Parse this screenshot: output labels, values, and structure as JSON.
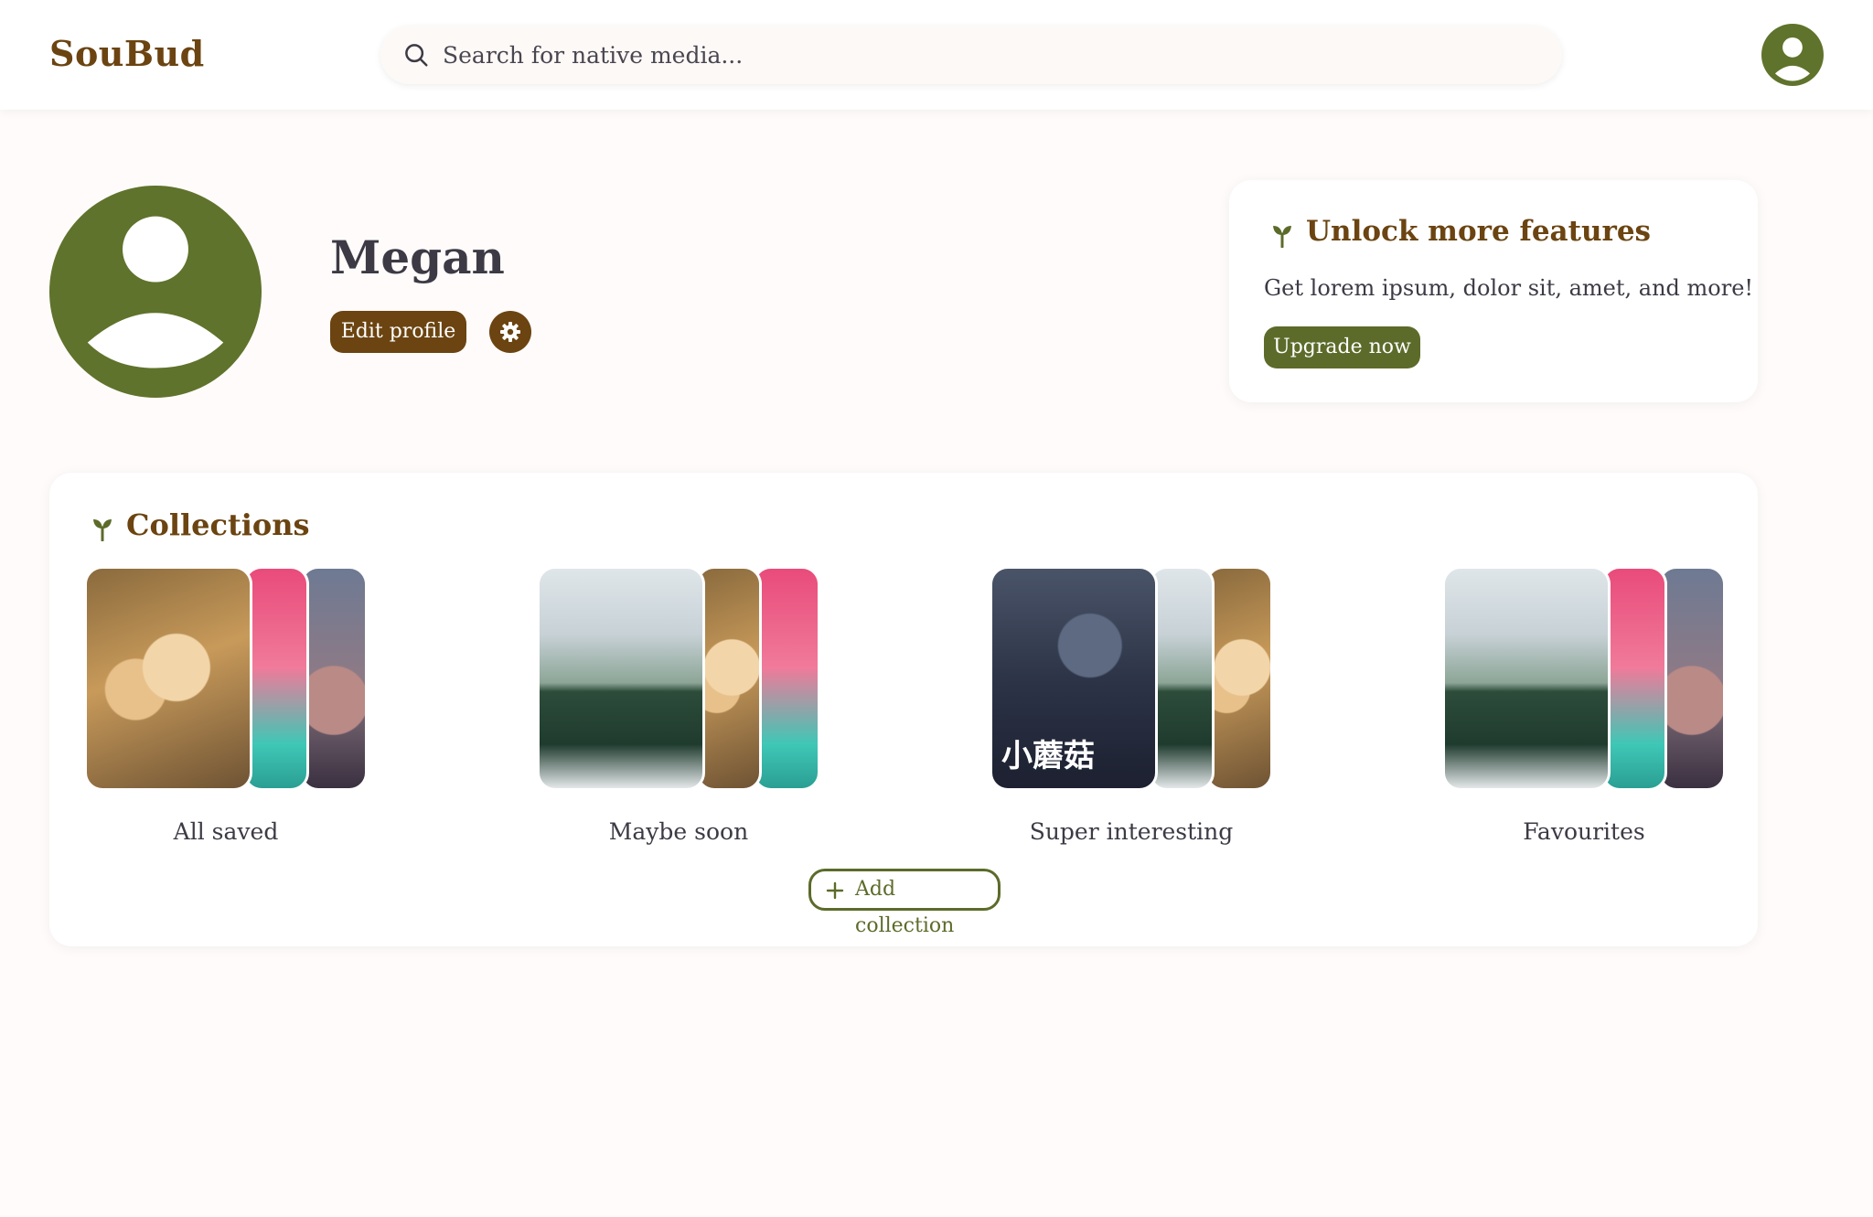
{
  "header": {
    "logo": "SouBud",
    "search_placeholder": "Search for native media...",
    "search_value": ""
  },
  "profile": {
    "name": "Megan",
    "edit_label": "Edit profile"
  },
  "promo": {
    "title": "Unlock more features",
    "text": "Get lorem ipsum, dolor sit, amet, and more!",
    "button_label": "Upgrade now"
  },
  "collections": {
    "title": "Collections",
    "items": [
      {
        "label": "All saved"
      },
      {
        "label": "Maybe soon"
      },
      {
        "label": "Super interesting",
        "poster_text": "小蘑菇"
      },
      {
        "label": "Favourites"
      }
    ],
    "add_label": "Add collection"
  },
  "colors": {
    "brand_brown": "#6b4411",
    "brand_olive": "#5c6b2a",
    "avatar_green": "#5f732c",
    "background": "#fefbfa"
  },
  "icons": [
    "search-icon",
    "user-avatar-icon",
    "gear-icon",
    "sprout-icon",
    "plus-icon"
  ]
}
